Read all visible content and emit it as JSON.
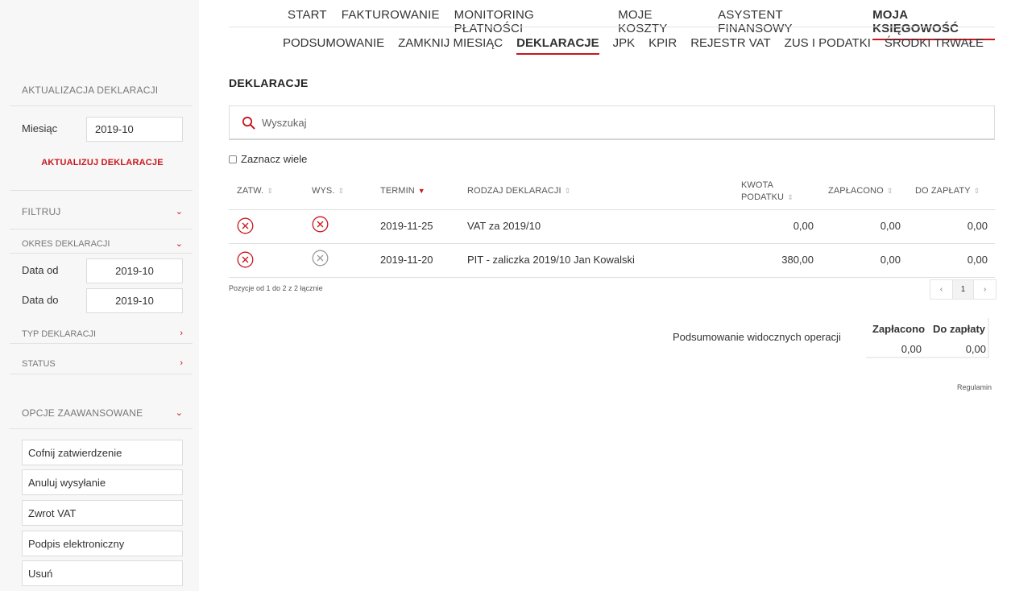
{
  "sidebar": {
    "update_title": "AKTUALIZACJA DEKLARACJI",
    "month_label": "Miesiąc",
    "month_value": "2019-10",
    "update_link": "AKTUALIZUJ DEKLARACJE",
    "filter_title": "FILTRUJ",
    "period_title": "OKRES DEKLARACJI",
    "date_from_label": "Data od",
    "date_from_value": "2019-10",
    "date_to_label": "Data do",
    "date_to_value": "2019-10",
    "type_title": "TYP DEKLARACJI",
    "status_title": "STATUS",
    "advanced_title": "OPCJE ZAAWANSOWANE",
    "buttons": [
      "Cofnij zatwierdzenie",
      "Anuluj wysyłanie",
      "Zwrot VAT",
      "Podpis elektroniczny",
      "Usuń"
    ]
  },
  "nav": {
    "main": [
      "START",
      "FAKTUROWANIE",
      "MONITORING PŁATNOŚCI",
      "MOJE KOSZTY",
      "ASYSTENT FINANSOWY",
      "MOJA KSIĘGOWOŚĆ"
    ],
    "sub": [
      "PODSUMOWANIE",
      "ZAMKNIJ MIESIĄC",
      "DEKLARACJE",
      "JPK",
      "KPIR",
      "REJESTR VAT",
      "ZUS I PODATKI",
      "ŚRODKI TRWAŁE"
    ]
  },
  "main": {
    "title": "DEKLARACJE",
    "search_placeholder": "Wyszukaj",
    "select_many": "Zaznacz wiele",
    "columns": {
      "approved": "ZATW.",
      "sent": "WYS.",
      "due": "TERMIN",
      "type": "RODZAJ DEKLARACJI",
      "tax_line1": "KWOTA",
      "tax_line2": "PODATKU",
      "paid": "ZAPŁACONO",
      "to_pay": "DO ZAPŁATY"
    },
    "rows": [
      {
        "due": "2019-11-25",
        "type": "VAT za 2019/10",
        "tax": "0,00",
        "paid": "0,00",
        "to_pay": "0,00"
      },
      {
        "due": "2019-11-20",
        "type": "PIT - zaliczka 2019/10 Jan Kowalski",
        "tax": "380,00",
        "paid": "0,00",
        "to_pay": "0,00"
      }
    ],
    "pagination_info": "Pozycje od 1 do 2 z 2 łącznie",
    "pagination": {
      "prev": "‹",
      "page": "1",
      "next": "›"
    },
    "summary_label": "Podsumowanie widocznych operacji",
    "summary_paid_header": "Zapłacono",
    "summary_topay_header": "Do zapłaty",
    "summary_paid_value": "0,00",
    "summary_topay_value": "0,00",
    "regulamin": "Regulamin"
  },
  "colors": {
    "accent": "#c8161d",
    "muted_icon": "#9a9a9a"
  }
}
